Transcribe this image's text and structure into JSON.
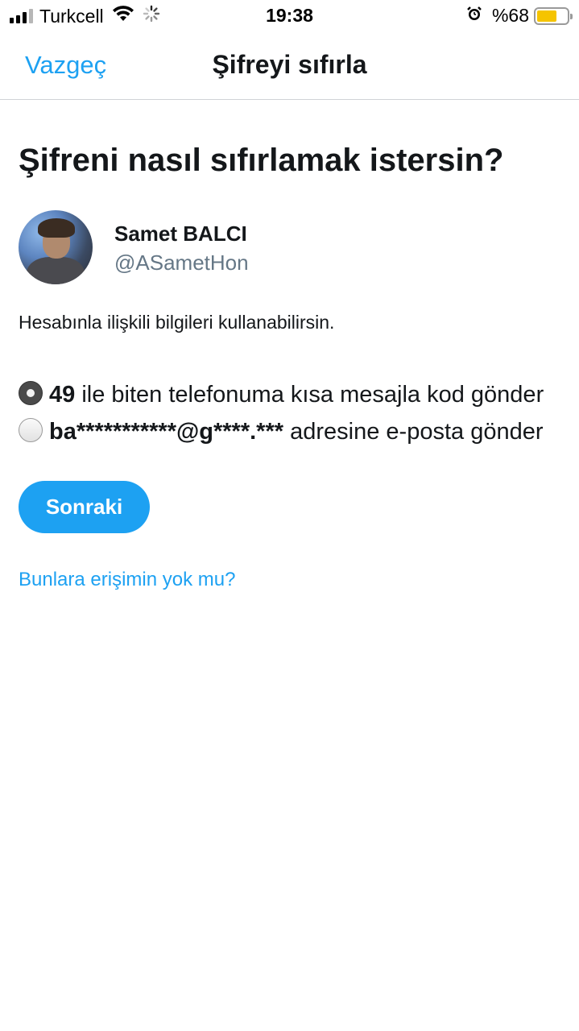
{
  "status_bar": {
    "carrier": "Turkcell",
    "time": "19:38",
    "battery": "%68",
    "battery_level": 0.68,
    "icons": [
      "signal-icon",
      "wifi-icon",
      "loading-spinner-icon",
      "alarm-icon",
      "battery-icon"
    ]
  },
  "nav": {
    "cancel_label": "Vazgeç",
    "title": "Şifreyi sıfırla"
  },
  "main": {
    "heading": "Şifreni nasıl sıfırlamak istersin?",
    "profile": {
      "name": "Samet BALCI",
      "handle": "@ASametHon"
    },
    "info_text": "Hesabınla ilişkili bilgileri kullanabilirsin.",
    "options": [
      {
        "bold": "49",
        "text": " ile biten telefonuma kısa mesajla kod gönder",
        "selected": true
      },
      {
        "bold": "ba***********@g****.***",
        "text": " adresine e-posta gönder",
        "selected": false
      }
    ],
    "next_button": "Sonraki",
    "no_access_link": "Bunlara erişimin yok mu?"
  },
  "colors": {
    "accent": "#1da1f2",
    "secondary_text": "#657786",
    "battery": "#f5c400"
  }
}
